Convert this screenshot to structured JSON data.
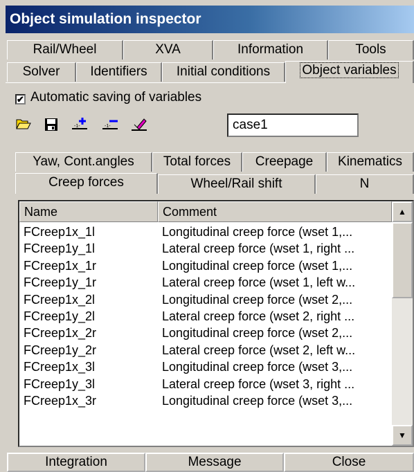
{
  "window": {
    "title": "Object simulation inspector"
  },
  "tabs_row1": [
    "Rail/Wheel",
    "XVA",
    "Information",
    "Tools"
  ],
  "tabs_row2": [
    "Solver",
    "Identifiers",
    "Initial conditions",
    "Object variables"
  ],
  "autosave": {
    "label": "Automatic saving of variables",
    "checked": true
  },
  "case_input": {
    "value": "case1"
  },
  "subtabs_row1": [
    "Yaw, Cont.angles",
    "Total forces",
    "Creepage",
    "Kinematics"
  ],
  "subtabs_row2": [
    "Creep forces",
    "Wheel/Rail shift",
    "N"
  ],
  "table": {
    "columns": [
      "Name",
      "Comment"
    ],
    "rows": [
      [
        "FCreep1x_1l",
        "Longitudinal creep force (wset 1,..."
      ],
      [
        "FCreep1y_1l",
        "Lateral creep force (wset 1, right ..."
      ],
      [
        "FCreep1x_1r",
        "Longitudinal creep force (wset 1,..."
      ],
      [
        "FCreep1y_1r",
        "Lateral creep force (wset 1, left w..."
      ],
      [
        "FCreep1x_2l",
        "Longitudinal creep force (wset 2,..."
      ],
      [
        "FCreep1y_2l",
        "Lateral creep force (wset 2, right ..."
      ],
      [
        "FCreep1x_2r",
        "Longitudinal creep force (wset 2,..."
      ],
      [
        "FCreep1y_2r",
        "Lateral creep force (wset 2, left w..."
      ],
      [
        "FCreep1x_3l",
        "Longitudinal creep force (wset 3,..."
      ],
      [
        "FCreep1y_3l",
        "Lateral creep force (wset 3, right ..."
      ],
      [
        "FCreep1x_3r",
        "Longitudinal creep force (wset 3,..."
      ]
    ]
  },
  "buttons": [
    "Integration",
    "Message",
    "Close"
  ],
  "icons": [
    "folder-open-icon",
    "save-icon",
    "add-variable-icon",
    "remove-variable-icon",
    "edit-variable-icon"
  ],
  "colors": {
    "title_start": "#0a246a",
    "title_end": "#a6caf0",
    "face": "#d4d0c8"
  }
}
